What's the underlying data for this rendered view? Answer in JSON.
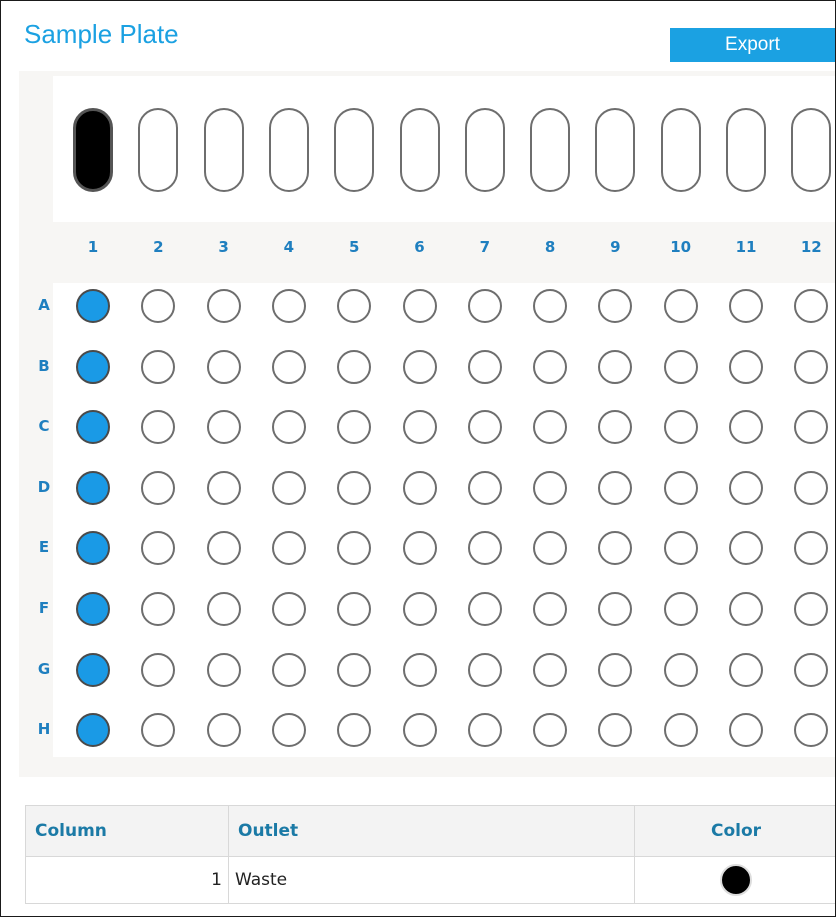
{
  "header": {
    "title": "Sample Plate",
    "export_label": "Export"
  },
  "plate": {
    "columns": [
      "1",
      "2",
      "3",
      "4",
      "5",
      "6",
      "7",
      "8",
      "9",
      "10",
      "11",
      "12"
    ],
    "rows": [
      "A",
      "B",
      "C",
      "D",
      "E",
      "F",
      "G",
      "H"
    ],
    "selected_lane_column": "1",
    "filled_wells": {
      "A": [
        "1"
      ],
      "B": [
        "1"
      ],
      "C": [
        "1"
      ],
      "D": [
        "1"
      ],
      "E": [
        "1"
      ],
      "F": [
        "1"
      ],
      "G": [
        "1"
      ],
      "H": [
        "1"
      ]
    },
    "colors": {
      "lane_selected": "#000000",
      "well_filled": "#1a9ae6",
      "well_outline": "#6e6e6e",
      "header_text": "#1f7fbf"
    }
  },
  "table": {
    "headers": {
      "column": "Column",
      "outlet": "Outlet",
      "color": "Color"
    },
    "rows": [
      {
        "column": "1",
        "outlet": "Waste",
        "color": "#000000"
      }
    ]
  }
}
